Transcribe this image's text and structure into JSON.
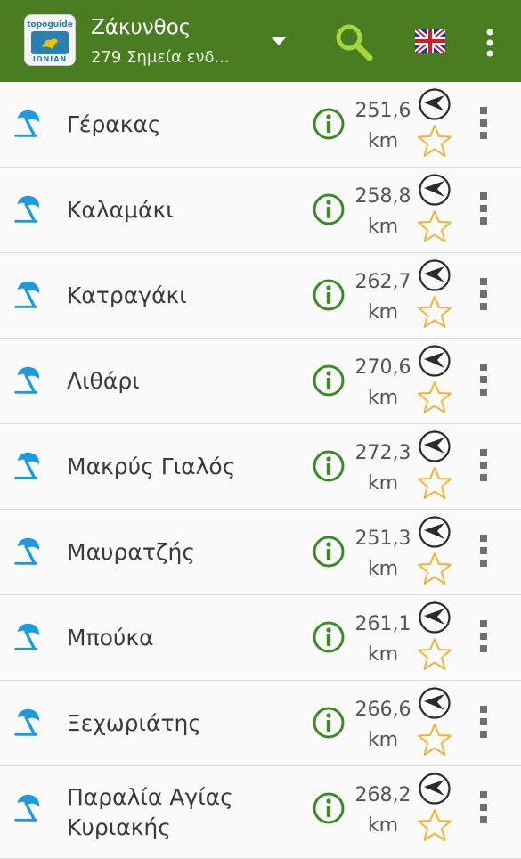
{
  "appbar": {
    "title": "Ζάκυνθος",
    "subtitle": "279 Σημεία ενδ...",
    "logo_top": "topoguide",
    "logo_bottom": "ΙΟΝΙΑΝ",
    "color": "#4a7d22",
    "icons": [
      "dropdown-arrow-icon",
      "search-icon",
      "uk-flag-icon",
      "overflow-menu-icon"
    ]
  },
  "colors": {
    "beach_icon": "#1e9be0",
    "info_icon": "#3d8b27",
    "star_icon": "#f0b43a",
    "nav_icon": "#2b2b2b"
  },
  "unit": "km",
  "items": [
    {
      "name": "Γέρακας",
      "distance": "251,6"
    },
    {
      "name": "Καλαμάκι",
      "distance": "258,8"
    },
    {
      "name": "Κατραγάκι",
      "distance": "262,7"
    },
    {
      "name": "Λιθάρι",
      "distance": "270,6"
    },
    {
      "name": "Μακρύς Γιαλός",
      "distance": "272,3"
    },
    {
      "name": "Μαυρατζής",
      "distance": "251,3"
    },
    {
      "name": "Μπούκα",
      "distance": "261,1"
    },
    {
      "name": "Ξεχωριάτης",
      "distance": "266,6"
    },
    {
      "name": "Παραλία Αγίας Κυριακής",
      "distance": "268,2"
    }
  ]
}
